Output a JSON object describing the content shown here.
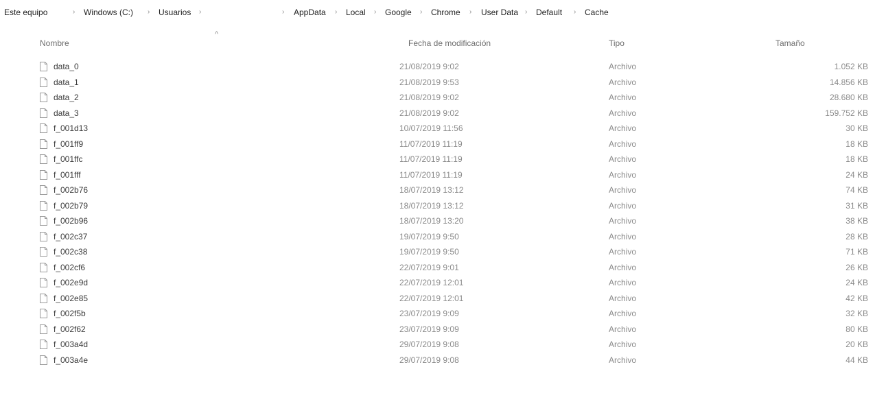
{
  "breadcrumb": [
    "Este equipo",
    "Windows (C:)",
    "Usuarios",
    "AppData",
    "Local",
    "Google",
    "Chrome",
    "User Data",
    "Default",
    "Cache"
  ],
  "columns": {
    "name": "Nombre",
    "date": "Fecha de modificación",
    "type": "Tipo",
    "size": "Tamaño"
  },
  "files": [
    {
      "name": "data_0",
      "date": "21/08/2019 9:02",
      "type": "Archivo",
      "size": "1.052 KB"
    },
    {
      "name": "data_1",
      "date": "21/08/2019 9:53",
      "type": "Archivo",
      "size": "14.856 KB"
    },
    {
      "name": "data_2",
      "date": "21/08/2019 9:02",
      "type": "Archivo",
      "size": "28.680 KB"
    },
    {
      "name": "data_3",
      "date": "21/08/2019 9:02",
      "type": "Archivo",
      "size": "159.752 KB"
    },
    {
      "name": "f_001d13",
      "date": "10/07/2019 11:56",
      "type": "Archivo",
      "size": "30 KB"
    },
    {
      "name": "f_001ff9",
      "date": "11/07/2019 11:19",
      "type": "Archivo",
      "size": "18 KB"
    },
    {
      "name": "f_001ffc",
      "date": "11/07/2019 11:19",
      "type": "Archivo",
      "size": "18 KB"
    },
    {
      "name": "f_001fff",
      "date": "11/07/2019 11:19",
      "type": "Archivo",
      "size": "24 KB"
    },
    {
      "name": "f_002b76",
      "date": "18/07/2019 13:12",
      "type": "Archivo",
      "size": "74 KB"
    },
    {
      "name": "f_002b79",
      "date": "18/07/2019 13:12",
      "type": "Archivo",
      "size": "31 KB"
    },
    {
      "name": "f_002b96",
      "date": "18/07/2019 13:20",
      "type": "Archivo",
      "size": "38 KB"
    },
    {
      "name": "f_002c37",
      "date": "19/07/2019 9:50",
      "type": "Archivo",
      "size": "28 KB"
    },
    {
      "name": "f_002c38",
      "date": "19/07/2019 9:50",
      "type": "Archivo",
      "size": "71 KB"
    },
    {
      "name": "f_002cf6",
      "date": "22/07/2019 9:01",
      "type": "Archivo",
      "size": "26 KB"
    },
    {
      "name": "f_002e9d",
      "date": "22/07/2019 12:01",
      "type": "Archivo",
      "size": "24 KB"
    },
    {
      "name": "f_002e85",
      "date": "22/07/2019 12:01",
      "type": "Archivo",
      "size": "42 KB"
    },
    {
      "name": "f_002f5b",
      "date": "23/07/2019 9:09",
      "type": "Archivo",
      "size": "32 KB"
    },
    {
      "name": "f_002f62",
      "date": "23/07/2019 9:09",
      "type": "Archivo",
      "size": "80 KB"
    },
    {
      "name": "f_003a4d",
      "date": "29/07/2019 9:08",
      "type": "Archivo",
      "size": "20 KB"
    },
    {
      "name": "f_003a4e",
      "date": "29/07/2019 9:08",
      "type": "Archivo",
      "size": "44 KB"
    }
  ]
}
